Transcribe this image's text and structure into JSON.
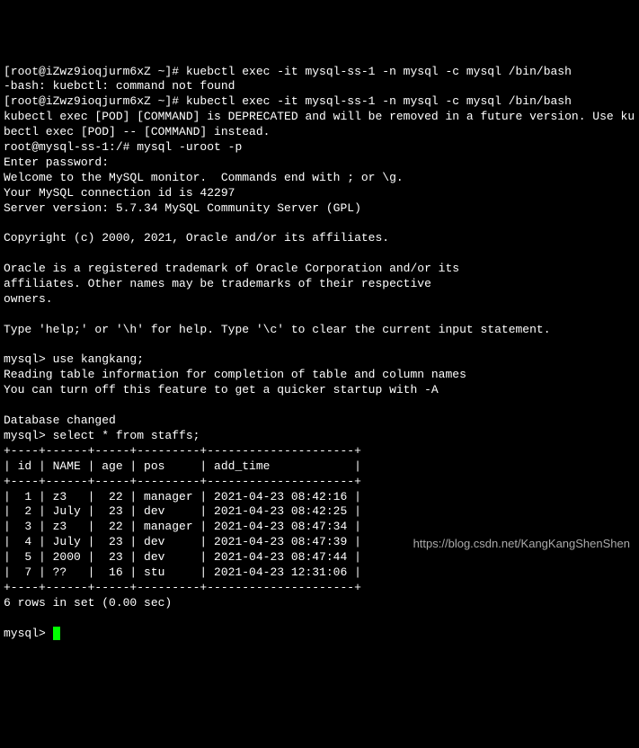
{
  "lines": {
    "l1": "[root@iZwz9ioqjurm6xZ ~]# kuebctl exec -it mysql-ss-1 -n mysql -c mysql /bin/bash",
    "l2": "-bash: kuebctl: command not found",
    "l3": "[root@iZwz9ioqjurm6xZ ~]# kubectl exec -it mysql-ss-1 -n mysql -c mysql /bin/bash",
    "l4": "kubectl exec [POD] [COMMAND] is DEPRECATED and will be removed in a future version. Use kubectl exec [POD] -- [COMMAND] instead.",
    "l5": "root@mysql-ss-1:/# mysql -uroot -p",
    "l6": "Enter password:",
    "l7": "Welcome to the MySQL monitor.  Commands end with ; or \\g.",
    "l8": "Your MySQL connection id is 42297",
    "l9": "Server version: 5.7.34 MySQL Community Server (GPL)",
    "l10": "",
    "l11": "Copyright (c) 2000, 2021, Oracle and/or its affiliates.",
    "l12": "",
    "l13": "Oracle is a registered trademark of Oracle Corporation and/or its",
    "l14": "affiliates. Other names may be trademarks of their respective",
    "l15": "owners.",
    "l16": "",
    "l17": "Type 'help;' or '\\h' for help. Type '\\c' to clear the current input statement.",
    "l18": "",
    "l19": "mysql> use kangkang;",
    "l20": "Reading table information for completion of table and column names",
    "l21": "You can turn off this feature to get a quicker startup with -A",
    "l22": "",
    "l23": "Database changed",
    "l24": "mysql> select * from staffs;",
    "l25": "+----+------+-----+---------+---------------------+",
    "l26": "| id | NAME | age | pos     | add_time            |",
    "l27": "+----+------+-----+---------+---------------------+",
    "l28": "|  1 | z3   |  22 | manager | 2021-04-23 08:42:16 |",
    "l29": "|  2 | July |  23 | dev     | 2021-04-23 08:42:25 |",
    "l30": "|  3 | z3   |  22 | manager | 2021-04-23 08:47:34 |",
    "l31": "|  4 | July |  23 | dev     | 2021-04-23 08:47:39 |",
    "l32": "|  5 | 2000 |  23 | dev     | 2021-04-23 08:47:44 |",
    "l33": "|  7 | ??   |  16 | stu     | 2021-04-23 12:31:06 |",
    "l34": "+----+------+-----+---------+---------------------+",
    "l35": "6 rows in set (0.00 sec)",
    "l36": "",
    "l37": "mysql> "
  },
  "chart_data": {
    "type": "table",
    "title": "staffs",
    "columns": [
      "id",
      "NAME",
      "age",
      "pos",
      "add_time"
    ],
    "rows": [
      {
        "id": 1,
        "NAME": "z3",
        "age": 22,
        "pos": "manager",
        "add_time": "2021-04-23 08:42:16"
      },
      {
        "id": 2,
        "NAME": "July",
        "age": 23,
        "pos": "dev",
        "add_time": "2021-04-23 08:42:25"
      },
      {
        "id": 3,
        "NAME": "z3",
        "age": 22,
        "pos": "manager",
        "add_time": "2021-04-23 08:47:34"
      },
      {
        "id": 4,
        "NAME": "July",
        "age": 23,
        "pos": "dev",
        "add_time": "2021-04-23 08:47:39"
      },
      {
        "id": 5,
        "NAME": "2000",
        "age": 23,
        "pos": "dev",
        "add_time": "2021-04-23 08:47:44"
      },
      {
        "id": 7,
        "NAME": "??",
        "age": 16,
        "pos": "stu",
        "add_time": "2021-04-23 12:31:06"
      }
    ],
    "summary": "6 rows in set (0.00 sec)"
  },
  "watermark": "https://blog.csdn.net/KangKangShenShen"
}
